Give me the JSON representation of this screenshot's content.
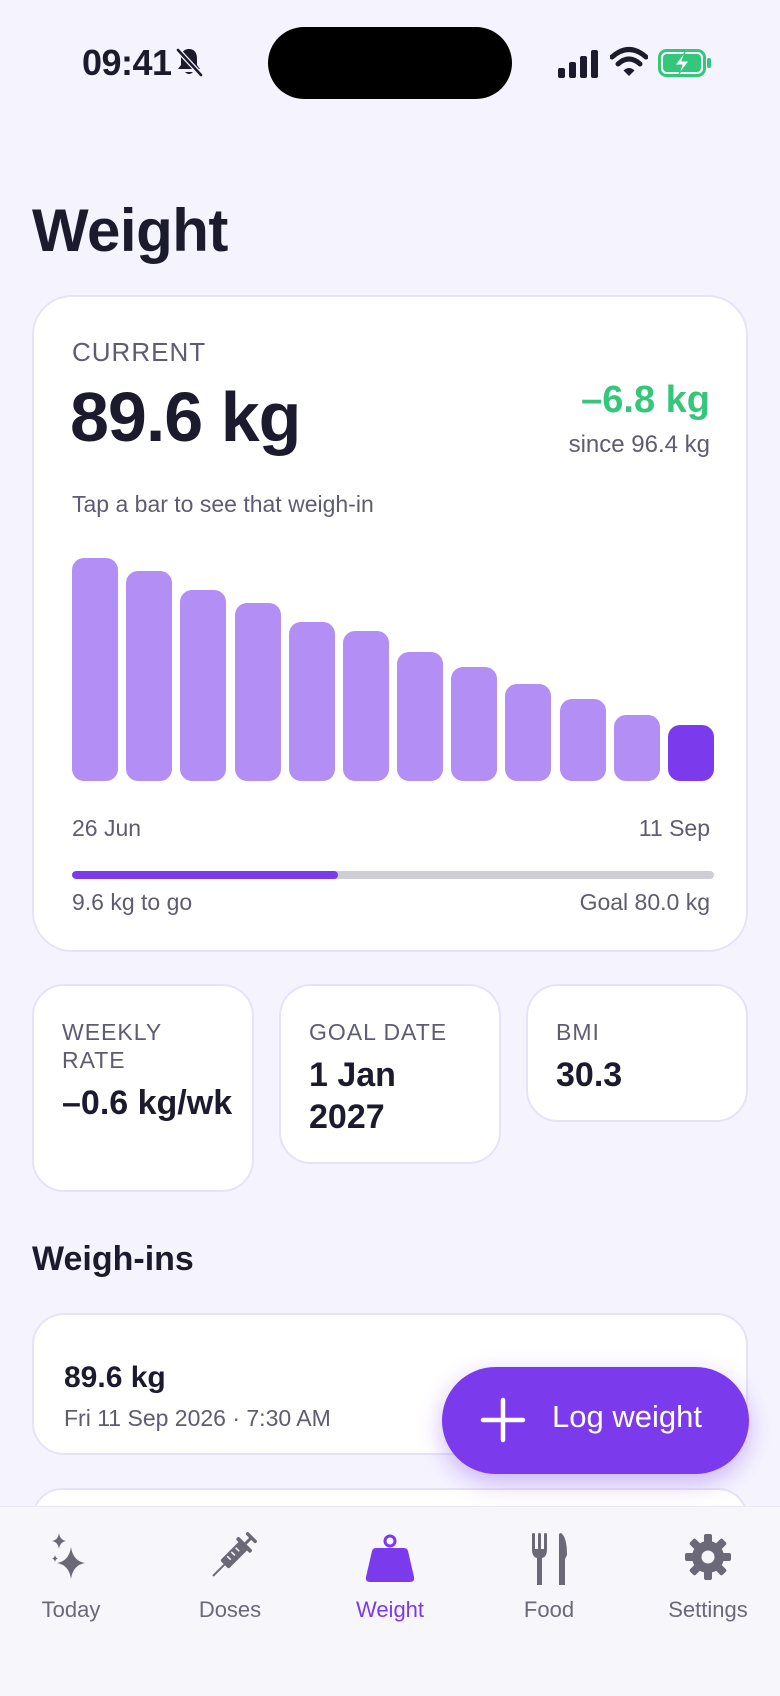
{
  "status_bar": {
    "time": "09:41"
  },
  "page": {
    "title": "Weight"
  },
  "current": {
    "label": "CURRENT",
    "value": "89.6 kg",
    "delta": "–6.8 kg",
    "since": "since 96.4 kg",
    "hint": "Tap a bar to see that weigh-in"
  },
  "chart_data": {
    "type": "bar",
    "unit": "kg",
    "first_date_label": "26 Jun",
    "last_date_label": "11 Sep",
    "values": [
      96.4,
      95.8,
      94.9,
      94.3,
      93.4,
      93.0,
      92.0,
      91.3,
      90.5,
      89.8,
      89.1,
      88.6
    ],
    "ylim": [
      86,
      97
    ],
    "selected_index": 11,
    "colors": {
      "bar": "#b38ff5",
      "selected": "#7c3aed"
    }
  },
  "progress": {
    "fraction": 0.415,
    "to_go": "9.6 kg to go",
    "goal": "Goal 80.0 kg"
  },
  "stats": [
    {
      "label": "WEEKLY RATE",
      "value": "–0.6 kg/wk"
    },
    {
      "label": "GOAL DATE",
      "value": "1 Jan 2027"
    },
    {
      "label": "BMI",
      "value": "30.3"
    }
  ],
  "weighins": {
    "title": "Weigh-ins",
    "items": [
      {
        "weight": "89.6 kg",
        "date": "Fri 11 Sep 2026 · 7:30 AM"
      }
    ]
  },
  "fab": {
    "label": "Log weight"
  },
  "tabs": [
    {
      "label": "Today",
      "icon": "sparkles-icon",
      "active": false
    },
    {
      "label": "Doses",
      "icon": "syringe-icon",
      "active": false
    },
    {
      "label": "Weight",
      "icon": "scale-icon",
      "active": true
    },
    {
      "label": "Food",
      "icon": "fork-knife-icon",
      "active": false
    },
    {
      "label": "Settings",
      "icon": "gear-icon",
      "active": false
    }
  ],
  "colors": {
    "accent": "#7c3aed",
    "positive": "#34c77b",
    "background": "#f5f4fe"
  }
}
